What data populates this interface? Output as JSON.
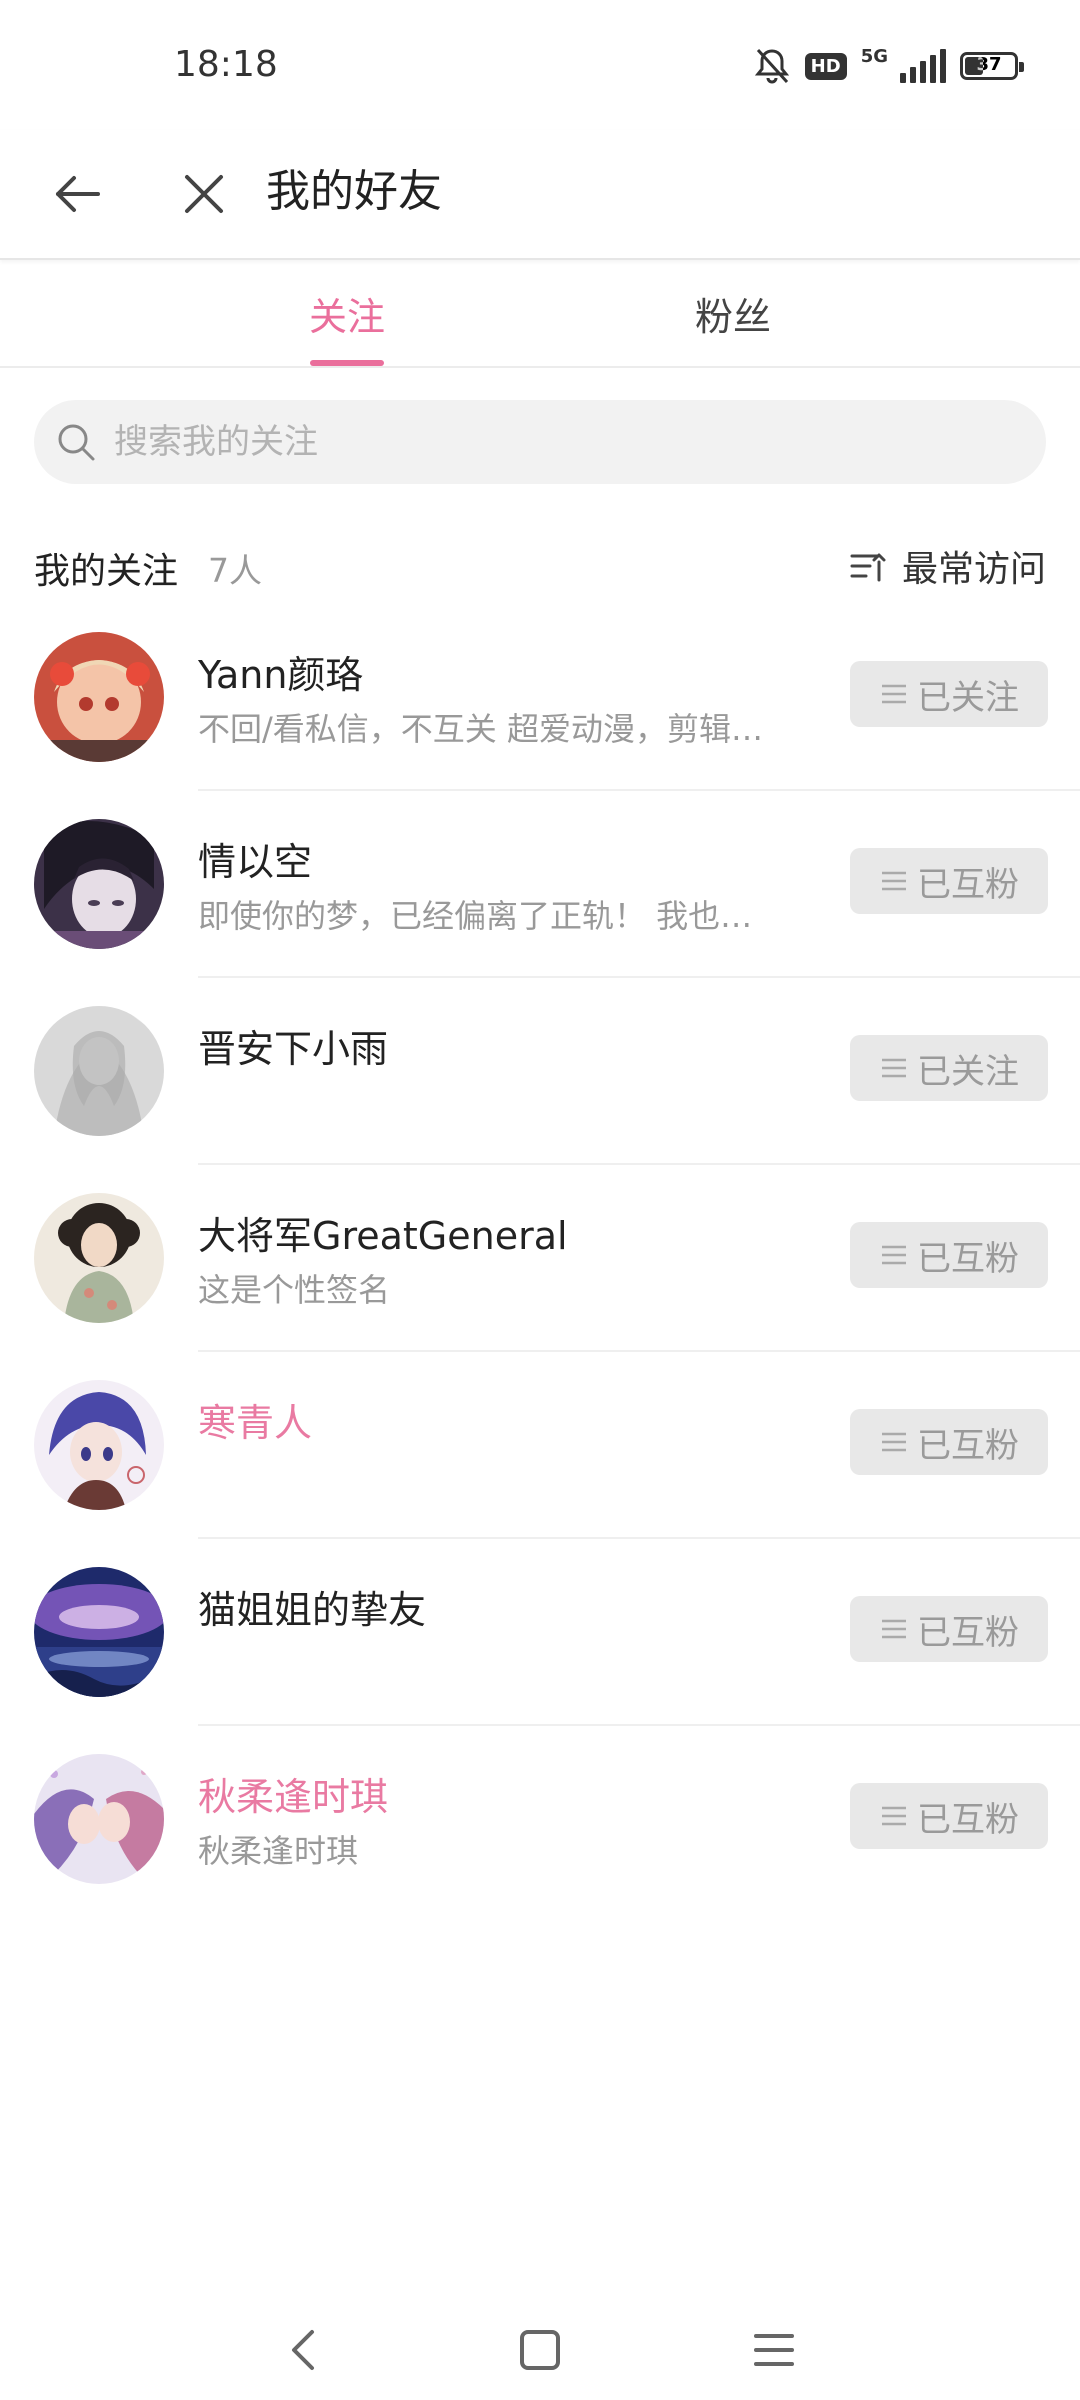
{
  "status_bar": {
    "time": "18:18",
    "network": "5G",
    "hd": "HD",
    "battery": "37",
    "battery_level": 0.37
  },
  "header": {
    "title": "我的好友"
  },
  "tabs": [
    {
      "label": "关注",
      "active": true
    },
    {
      "label": "粉丝",
      "active": false
    }
  ],
  "search": {
    "placeholder": "搜索我的关注",
    "value": ""
  },
  "section": {
    "title": "我的关注",
    "count": "7人",
    "sort_label": "最常访问"
  },
  "colors": {
    "accent": "#ea6f9c",
    "pink_name": "#e97aa2",
    "button_bg": "#e8e8e8",
    "muted_text": "#999999"
  },
  "rows": [
    {
      "name": "Yann颜珞",
      "signature": "不回/看私信，不互关 超爱动漫，剪辑…",
      "button": "已关注",
      "pink": false,
      "avatar": "avatar-anime-girl-red"
    },
    {
      "name": "情以空",
      "signature": "即使你的梦，已经偏离了正轨！ 我也…",
      "button": "已互粉",
      "pink": false,
      "avatar": "avatar-dark-portrait"
    },
    {
      "name": "晋安下小雨",
      "signature": "",
      "button": "已关注",
      "pink": false,
      "avatar": "avatar-grey-sketch"
    },
    {
      "name": "大将军GreatGeneral",
      "signature": "这是个性签名",
      "button": "已互粉",
      "pink": false,
      "avatar": "avatar-vintage-girl"
    },
    {
      "name": "寒青人",
      "signature": "",
      "button": "已互粉",
      "pink": true,
      "avatar": "avatar-anime-boy"
    },
    {
      "name": "猫姐姐的挚友",
      "signature": "",
      "button": "已互粉",
      "pink": false,
      "avatar": "avatar-night-sky"
    },
    {
      "name": "秋柔逢时琪",
      "signature": "秋柔逢时琪",
      "button": "已互粉",
      "pink": true,
      "avatar": "avatar-anime-couple"
    }
  ]
}
